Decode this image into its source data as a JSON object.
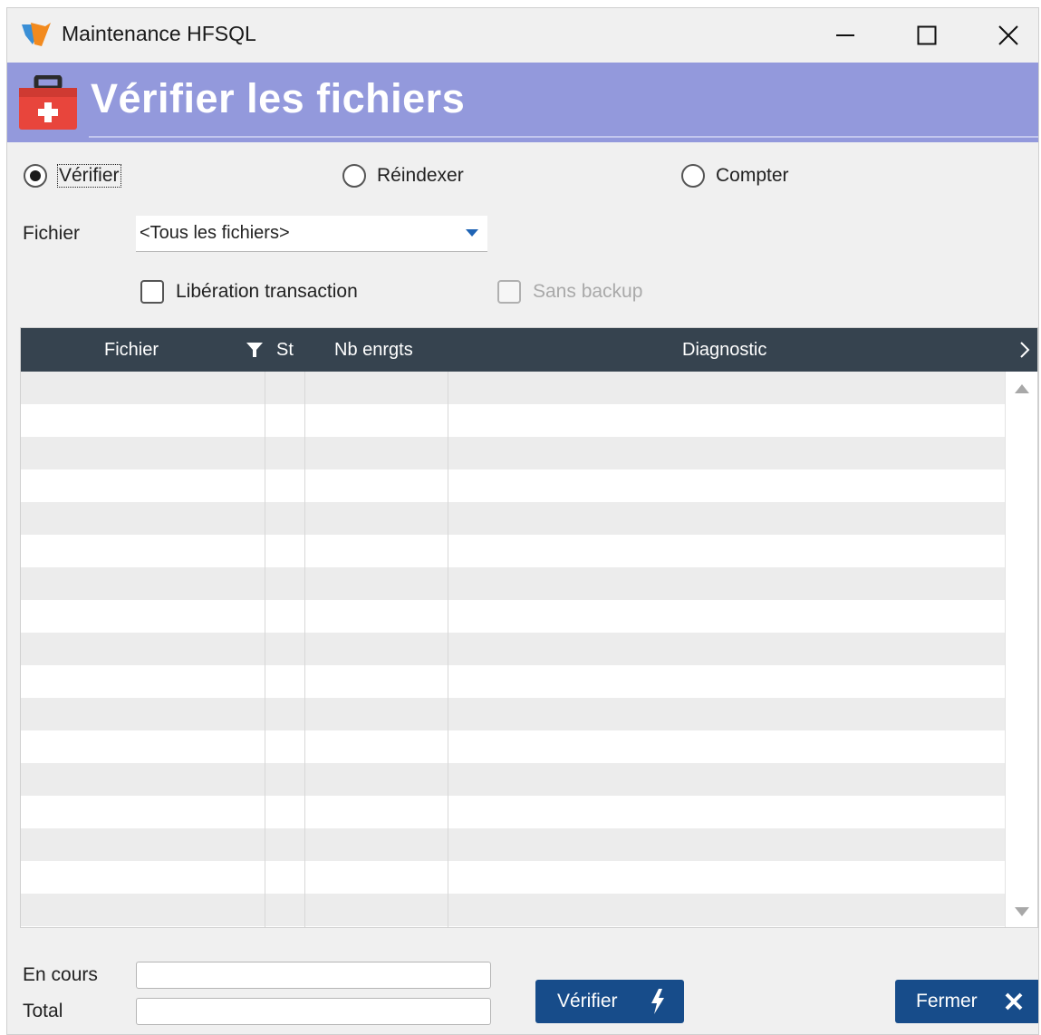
{
  "window": {
    "title": "Maintenance HFSQL"
  },
  "header": {
    "title": "Vérifier les fichiers"
  },
  "modes": [
    {
      "label": "Vérifier",
      "selected": true
    },
    {
      "label": "Réindexer",
      "selected": false
    },
    {
      "label": "Compter",
      "selected": false
    }
  ],
  "file_filter": {
    "label": "Fichier",
    "value": "<Tous les fichiers>"
  },
  "options": [
    {
      "label": "Libération transaction",
      "checked": false,
      "enabled": true
    },
    {
      "label": "Sans backup",
      "checked": false,
      "enabled": false
    }
  ],
  "table": {
    "columns": [
      "Fichier",
      "St",
      "Nb enrgts",
      "Diagnostic"
    ],
    "rows": []
  },
  "progress": {
    "current_label": "En cours",
    "total_label": "Total"
  },
  "buttons": {
    "verify": "Vérifier",
    "close": "Fermer"
  },
  "colors": {
    "header_band": "#9399dc",
    "table_header": "#36434f",
    "button": "#174c8a",
    "combo_arrow": "#1f64b5"
  },
  "icons": [
    "app-logo-icon",
    "first-aid-kit-icon",
    "minimize-icon",
    "maximize-icon",
    "close-icon",
    "filter-icon",
    "chevron-right-icon",
    "scroll-up-icon",
    "scroll-down-icon",
    "lightning-icon",
    "x-icon"
  ]
}
